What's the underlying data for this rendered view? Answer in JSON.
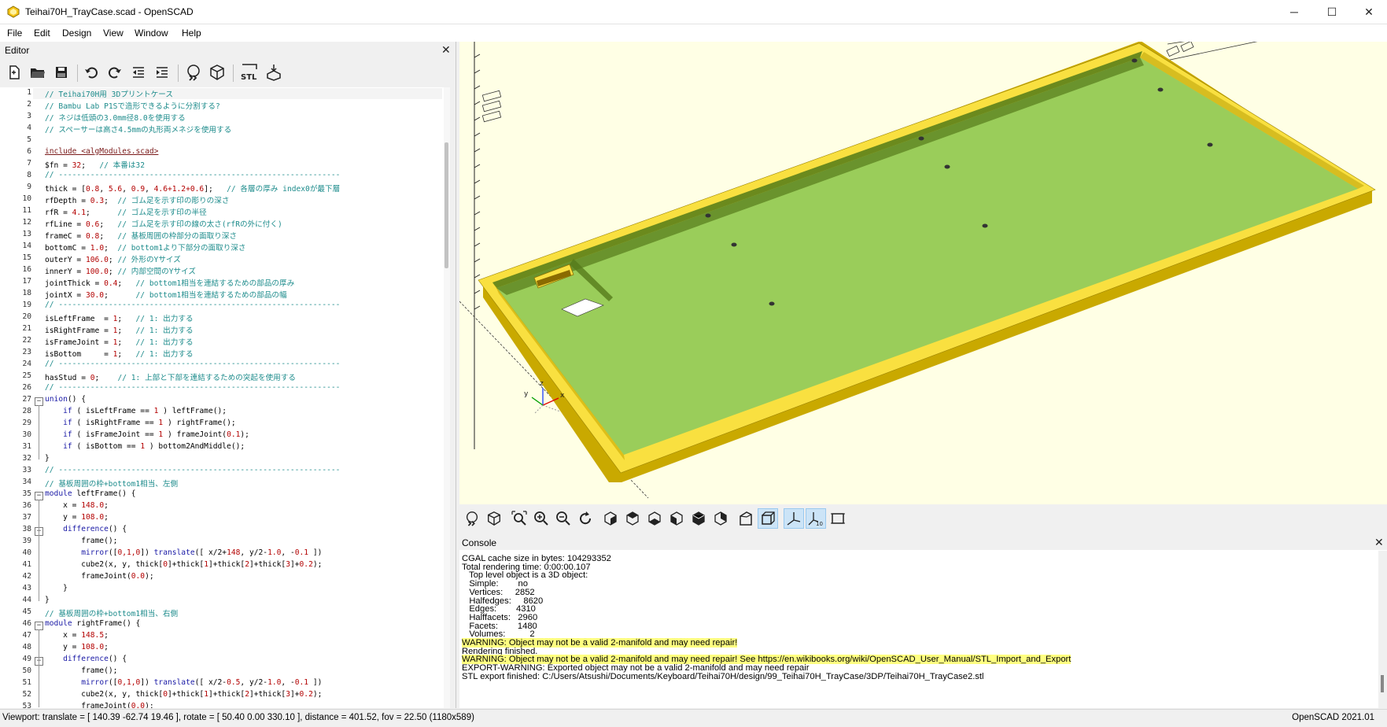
{
  "window": {
    "title": "Teihai70H_TrayCase.scad - OpenSCAD",
    "minimize": "─",
    "maximize": "☐",
    "close": "✕"
  },
  "menu": [
    "File",
    "Edit",
    "Design",
    "View",
    "Window",
    "Help"
  ],
  "editor": {
    "title": "Editor",
    "close": "✕",
    "toolbar_icons": [
      "new-file-icon",
      "open-file-icon",
      "save-icon",
      "undo-icon",
      "redo-icon",
      "unindent-icon",
      "indent-icon",
      "preview-icon",
      "render-icon",
      "export-stl-icon",
      "send-to-print-icon"
    ],
    "lines": [
      [
        {
          "t": "// Teihai70H用 3Dプリントケース",
          "c": "cm"
        }
      ],
      [
        {
          "t": "// Bambu Lab P1Sで造形できるように分割する?",
          "c": "cm"
        }
      ],
      [
        {
          "t": "// ネジは低頭の3.0mm径8.0を使用する",
          "c": "cm"
        }
      ],
      [
        {
          "t": "// スペーサーは高さ4.5mmの丸形両メネジを使用する",
          "c": "cm"
        }
      ],
      [],
      [
        {
          "t": "include <algModules.scad>",
          "c": "inc"
        }
      ],
      [
        {
          "t": "$fn = "
        },
        {
          "t": "32",
          "c": "num"
        },
        {
          "t": ";   "
        },
        {
          "t": "// 本番は32",
          "c": "cm"
        }
      ],
      [
        {
          "t": "// --------------------------------------------------------------",
          "c": "cm"
        }
      ],
      [
        {
          "t": "thick = ["
        },
        {
          "t": "0.8",
          "c": "num"
        },
        {
          "t": ", "
        },
        {
          "t": "5.6",
          "c": "num"
        },
        {
          "t": ", "
        },
        {
          "t": "0.9",
          "c": "num"
        },
        {
          "t": ", "
        },
        {
          "t": "4.6+1.2+0.6",
          "c": "num"
        },
        {
          "t": "];   "
        },
        {
          "t": "// 各層の厚み index0が最下層",
          "c": "cm"
        }
      ],
      [
        {
          "t": "rfDepth = "
        },
        {
          "t": "0.3",
          "c": "num"
        },
        {
          "t": ";  "
        },
        {
          "t": "// ゴム足を示す印の彫りの深さ",
          "c": "cm"
        }
      ],
      [
        {
          "t": "rfR = "
        },
        {
          "t": "4.1",
          "c": "num"
        },
        {
          "t": ";      "
        },
        {
          "t": "// ゴム足を示す印の半径",
          "c": "cm"
        }
      ],
      [
        {
          "t": "rfLine = "
        },
        {
          "t": "0.6",
          "c": "num"
        },
        {
          "t": ";   "
        },
        {
          "t": "// ゴム足を示す印の線の太さ(rfRの外に付く)",
          "c": "cm"
        }
      ],
      [
        {
          "t": "frameC = "
        },
        {
          "t": "0.8",
          "c": "num"
        },
        {
          "t": ";   "
        },
        {
          "t": "// 基板周囲の枠部分の面取り深さ",
          "c": "cm"
        }
      ],
      [
        {
          "t": "bottomC = "
        },
        {
          "t": "1.0",
          "c": "num"
        },
        {
          "t": ";  "
        },
        {
          "t": "// bottom1より下部分の面取り深さ",
          "c": "cm"
        }
      ],
      [
        {
          "t": "outerY = "
        },
        {
          "t": "106.0",
          "c": "num"
        },
        {
          "t": "; "
        },
        {
          "t": "// 外形のYサイズ",
          "c": "cm"
        }
      ],
      [
        {
          "t": "innerY = "
        },
        {
          "t": "100.0",
          "c": "num"
        },
        {
          "t": "; "
        },
        {
          "t": "// 内部空間のYサイズ",
          "c": "cm"
        }
      ],
      [
        {
          "t": "jointThick = "
        },
        {
          "t": "0.4",
          "c": "num"
        },
        {
          "t": ";   "
        },
        {
          "t": "// bottom1相当を連結するための部品の厚み",
          "c": "cm"
        }
      ],
      [
        {
          "t": "jointX = "
        },
        {
          "t": "30.0",
          "c": "num"
        },
        {
          "t": ";      "
        },
        {
          "t": "// bottom1相当を連結するための部品の幅",
          "c": "cm"
        }
      ],
      [
        {
          "t": "// --------------------------------------------------------------",
          "c": "cm"
        }
      ],
      [
        {
          "t": "isLeftFrame  = "
        },
        {
          "t": "1",
          "c": "num"
        },
        {
          "t": ";   "
        },
        {
          "t": "// 1: 出力する",
          "c": "cm"
        }
      ],
      [
        {
          "t": "isRightFrame = "
        },
        {
          "t": "1",
          "c": "num"
        },
        {
          "t": ";   "
        },
        {
          "t": "// 1: 出力する",
          "c": "cm"
        }
      ],
      [
        {
          "t": "isFrameJoint = "
        },
        {
          "t": "1",
          "c": "num"
        },
        {
          "t": ";   "
        },
        {
          "t": "// 1: 出力する",
          "c": "cm"
        }
      ],
      [
        {
          "t": "isBottom     = "
        },
        {
          "t": "1",
          "c": "num"
        },
        {
          "t": ";   "
        },
        {
          "t": "// 1: 出力する",
          "c": "cm"
        }
      ],
      [
        {
          "t": "// --------------------------------------------------------------",
          "c": "cm"
        }
      ],
      [
        {
          "t": "hasStud = "
        },
        {
          "t": "0",
          "c": "num"
        },
        {
          "t": ";    "
        },
        {
          "t": "// 1: 上部と下部を連結するための突起を使用する",
          "c": "cm"
        }
      ],
      [
        {
          "t": "// --------------------------------------------------------------",
          "c": "cm"
        }
      ],
      [
        {
          "t": "union",
          "c": "kw"
        },
        {
          "t": "() {"
        }
      ],
      [
        {
          "t": "    "
        },
        {
          "t": "if",
          "c": "kw"
        },
        {
          "t": " ( isLeftFrame == "
        },
        {
          "t": "1",
          "c": "num"
        },
        {
          "t": " ) leftFrame();"
        }
      ],
      [
        {
          "t": "    "
        },
        {
          "t": "if",
          "c": "kw"
        },
        {
          "t": " ( isRightFrame == "
        },
        {
          "t": "1",
          "c": "num"
        },
        {
          "t": " ) rightFrame();"
        }
      ],
      [
        {
          "t": "    "
        },
        {
          "t": "if",
          "c": "kw"
        },
        {
          "t": " ( isFrameJoint == "
        },
        {
          "t": "1",
          "c": "num"
        },
        {
          "t": " ) frameJoint("
        },
        {
          "t": "0.1",
          "c": "num"
        },
        {
          "t": ");"
        }
      ],
      [
        {
          "t": "    "
        },
        {
          "t": "if",
          "c": "kw"
        },
        {
          "t": " ( isBottom == "
        },
        {
          "t": "1",
          "c": "num"
        },
        {
          "t": " ) bottom2AndMiddle();"
        }
      ],
      [
        {
          "t": "}"
        }
      ],
      [
        {
          "t": "// --------------------------------------------------------------",
          "c": "cm"
        }
      ],
      [
        {
          "t": "// 基板周囲の枠+bottom1相当、左側",
          "c": "cm"
        }
      ],
      [
        {
          "t": "module",
          "c": "kw"
        },
        {
          "t": " leftFrame() {"
        }
      ],
      [
        {
          "t": "    x = "
        },
        {
          "t": "148.0",
          "c": "num"
        },
        {
          "t": ";"
        }
      ],
      [
        {
          "t": "    y = "
        },
        {
          "t": "108.0",
          "c": "num"
        },
        {
          "t": ";"
        }
      ],
      [
        {
          "t": "    "
        },
        {
          "t": "difference",
          "c": "kw"
        },
        {
          "t": "() {"
        }
      ],
      [
        {
          "t": "        frame();"
        }
      ],
      [
        {
          "t": "        "
        },
        {
          "t": "mirror",
          "c": "kw"
        },
        {
          "t": "(["
        },
        {
          "t": "0,1,0",
          "c": "num"
        },
        {
          "t": "]) "
        },
        {
          "t": "translate",
          "c": "kw"
        },
        {
          "t": "([ x/2+"
        },
        {
          "t": "148",
          "c": "num"
        },
        {
          "t": ", y/2-"
        },
        {
          "t": "1.0",
          "c": "num"
        },
        {
          "t": ", -"
        },
        {
          "t": "0.1",
          "c": "num"
        },
        {
          "t": " ])"
        }
      ],
      [
        {
          "t": "        cube2(x, y, thick["
        },
        {
          "t": "0",
          "c": "num"
        },
        {
          "t": "]+thick["
        },
        {
          "t": "1",
          "c": "num"
        },
        {
          "t": "]+thick["
        },
        {
          "t": "2",
          "c": "num"
        },
        {
          "t": "]+thick["
        },
        {
          "t": "3",
          "c": "num"
        },
        {
          "t": "]+"
        },
        {
          "t": "0.2",
          "c": "num"
        },
        {
          "t": ");"
        }
      ],
      [
        {
          "t": "        frameJoint("
        },
        {
          "t": "0.0",
          "c": "num"
        },
        {
          "t": ");"
        }
      ],
      [
        {
          "t": "    }"
        }
      ],
      [
        {
          "t": "}"
        }
      ],
      [
        {
          "t": "// 基板周囲の枠+bottom1相当、右側",
          "c": "cm"
        }
      ],
      [
        {
          "t": "module",
          "c": "kw"
        },
        {
          "t": " rightFrame() {"
        }
      ],
      [
        {
          "t": "    x = "
        },
        {
          "t": "148.5",
          "c": "num"
        },
        {
          "t": ";"
        }
      ],
      [
        {
          "t": "    y = "
        },
        {
          "t": "108.0",
          "c": "num"
        },
        {
          "t": ";"
        }
      ],
      [
        {
          "t": "    "
        },
        {
          "t": "difference",
          "c": "kw"
        },
        {
          "t": "() {"
        }
      ],
      [
        {
          "t": "        frame();"
        }
      ],
      [
        {
          "t": "        "
        },
        {
          "t": "mirror",
          "c": "kw"
        },
        {
          "t": "(["
        },
        {
          "t": "0,1,0",
          "c": "num"
        },
        {
          "t": "]) "
        },
        {
          "t": "translate",
          "c": "kw"
        },
        {
          "t": "([ x/2-"
        },
        {
          "t": "0.5",
          "c": "num"
        },
        {
          "t": ", y/2-"
        },
        {
          "t": "1.0",
          "c": "num"
        },
        {
          "t": ", -"
        },
        {
          "t": "0.1",
          "c": "num"
        },
        {
          "t": " ])"
        }
      ],
      [
        {
          "t": "        cube2(x, y, thick["
        },
        {
          "t": "0",
          "c": "num"
        },
        {
          "t": "]+thick["
        },
        {
          "t": "1",
          "c": "num"
        },
        {
          "t": "]+thick["
        },
        {
          "t": "2",
          "c": "num"
        },
        {
          "t": "]+thick["
        },
        {
          "t": "3",
          "c": "num"
        },
        {
          "t": "]+"
        },
        {
          "t": "0.2",
          "c": "num"
        },
        {
          "t": ");"
        }
      ],
      [
        {
          "t": "        frameJoint("
        },
        {
          "t": "0.0",
          "c": "num"
        },
        {
          "t": ");"
        }
      ]
    ],
    "fold_lines": [
      27,
      35,
      38,
      46,
      49
    ]
  },
  "viewport": {
    "background": "#ffffe5",
    "model_top_color": "#f9e040",
    "model_side_color": "#c9a900",
    "floor_color": "#9acd5a",
    "axis_labels": [
      "x",
      "y",
      "z"
    ]
  },
  "view_toolbar_icons": [
    "preview-icon",
    "render-icon",
    "view-all-icon",
    "zoom-in-icon",
    "zoom-out-icon",
    "reset-view-icon",
    "view-right-icon",
    "view-top-icon",
    "view-bottom-icon",
    "view-left-icon",
    "view-front-icon",
    "view-back-icon",
    "perspective-icon",
    "orthogonal-icon",
    "show-axes-icon",
    "show-scale-markers-icon",
    "show-edges-icon"
  ],
  "console": {
    "title": "Console",
    "close": "✕",
    "lines": [
      {
        "text": "CGAL cache size in bytes: 104293352",
        "warn": false
      },
      {
        "text": "Total rendering time: 0:00:00.107",
        "warn": false
      },
      {
        "text": "   Top level object is a 3D object:",
        "warn": false
      },
      {
        "text": "   Simple:        no",
        "warn": false
      },
      {
        "text": "   Vertices:     2852",
        "warn": false
      },
      {
        "text": "   Halfedges:     8620",
        "warn": false
      },
      {
        "text": "   Edges:        4310",
        "warn": false
      },
      {
        "text": "   Halffacets:   2960",
        "warn": false
      },
      {
        "text": "   Facets:        1480",
        "warn": false
      },
      {
        "text": "   Volumes:          2",
        "warn": false
      },
      {
        "text": "WARNING: Object may not be a valid 2-manifold and may need repair!",
        "warn": true
      },
      {
        "text": "Rendering finished.",
        "warn": false
      },
      {
        "text": "WARNING: Object may not be a valid 2-manifold and may need repair! See https://en.wikibooks.org/wiki/OpenSCAD_User_Manual/STL_Import_and_Export",
        "warn": true
      },
      {
        "text": "EXPORT-WARNING: Exported object may not be a valid 2-manifold and may need repair",
        "warn": false
      },
      {
        "text": "STL export finished: C:/Users/Atsushi/Documents/Keyboard/Teihai70H/design/99_Teihai70H_TrayCase/3DP/Teihai70H_TrayCase2.stl",
        "warn": false
      }
    ]
  },
  "status": {
    "viewport": "Viewport: translate = [ 140.39 -62.74 19.46 ], rotate = [ 50.40 0.00 330.10 ], distance = 401.52, fov = 22.50 (1180x589)",
    "version": "OpenSCAD 2021.01"
  }
}
